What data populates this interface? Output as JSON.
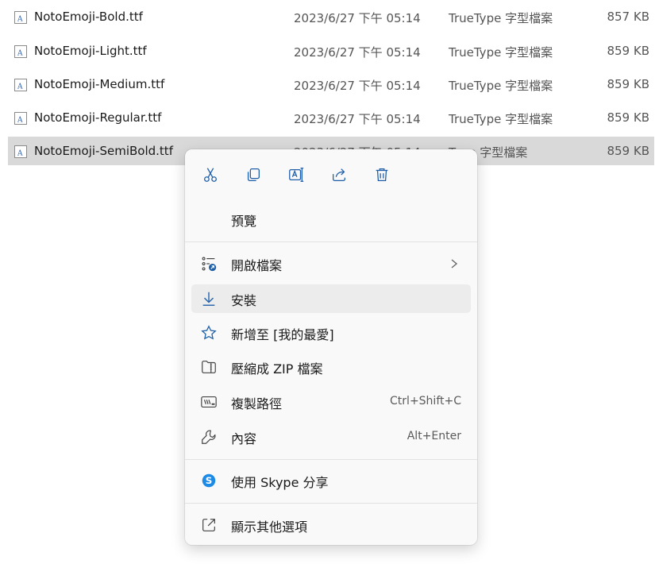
{
  "files": [
    {
      "name": "NotoEmoji-Bold.ttf",
      "date": "2023/6/27 下午 05:14",
      "type": "TrueType 字型檔案",
      "size": "857 KB"
    },
    {
      "name": "NotoEmoji-Light.ttf",
      "date": "2023/6/27 下午 05:14",
      "type": "TrueType 字型檔案",
      "size": "859 KB"
    },
    {
      "name": "NotoEmoji-Medium.ttf",
      "date": "2023/6/27 下午 05:14",
      "type": "TrueType 字型檔案",
      "size": "859 KB"
    },
    {
      "name": "NotoEmoji-Regular.ttf",
      "date": "2023/6/27 下午 05:14",
      "type": "TrueType 字型檔案",
      "size": "859 KB"
    },
    {
      "name": "NotoEmoji-SemiBold.ttf",
      "date": "2023/6/27 下午 05:14",
      "type": "Type 字型檔案",
      "size": "859 KB",
      "selected": true
    }
  ],
  "toolbar": {
    "icons": [
      "cut-icon",
      "copy-icon",
      "rename-icon",
      "share-icon",
      "delete-icon"
    ]
  },
  "menu": {
    "preview": "預覽",
    "open_file": "開啟檔案",
    "install": "安裝",
    "add_favorite": "新增至 [我的最愛]",
    "compress_zip": "壓縮成 ZIP 檔案",
    "copy_path": "複製路徑",
    "copy_path_shortcut": "Ctrl+Shift+C",
    "properties": "內容",
    "properties_shortcut": "Alt+Enter",
    "skype_share": "使用 Skype 分享",
    "more_options": "顯示其他選項"
  },
  "colors": {
    "accent": "#0f6cbd",
    "selection": "#d9d9d9",
    "menu_bg": "#f9f9f9",
    "skype": "#1d8ae6"
  }
}
